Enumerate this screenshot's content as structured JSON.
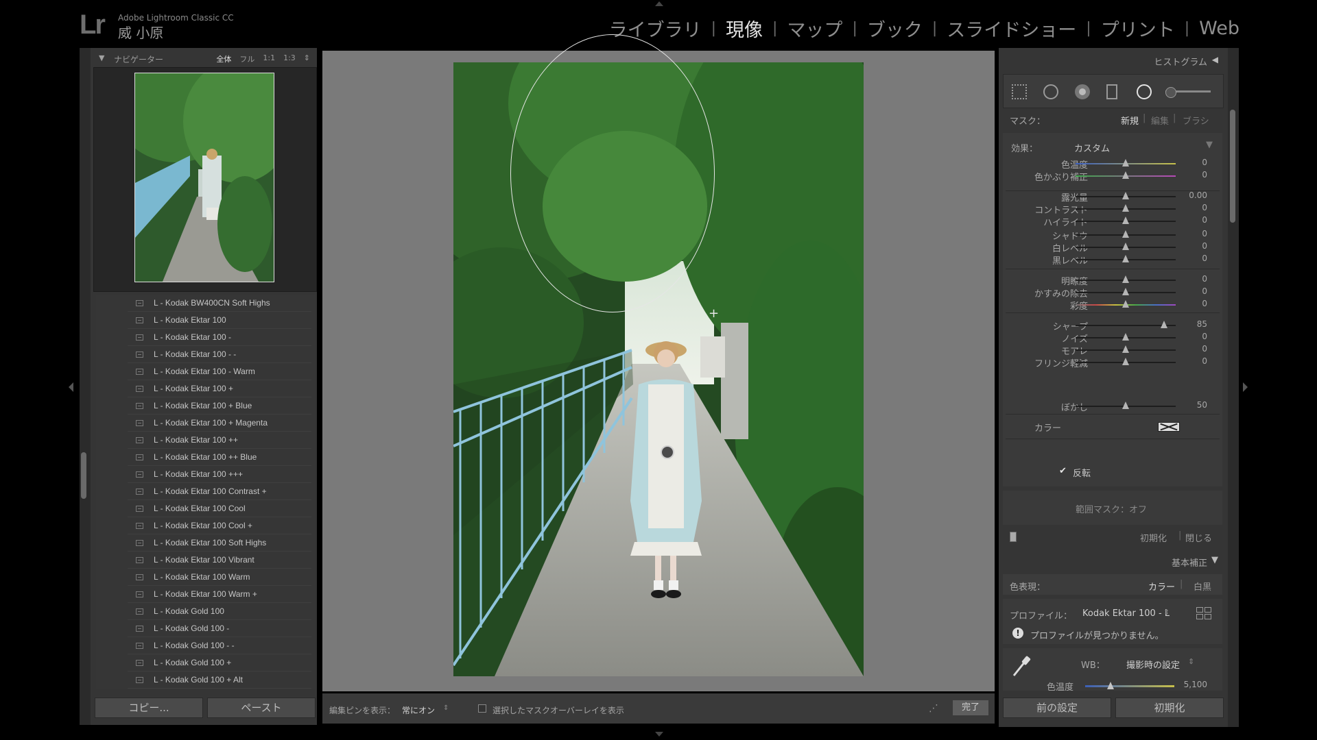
{
  "app": {
    "logo": "Lr",
    "product": "Adobe Lightroom Classic CC",
    "user": "威 小原"
  },
  "modules": [
    {
      "label": "ライブラリ",
      "active": false
    },
    {
      "label": "現像",
      "active": true
    },
    {
      "label": "マップ",
      "active": false
    },
    {
      "label": "ブック",
      "active": false
    },
    {
      "label": "スライドショー",
      "active": false
    },
    {
      "label": "プリント",
      "active": false
    },
    {
      "label": "Web",
      "active": false
    }
  ],
  "navigator": {
    "title": "ナビゲーター",
    "zoom_options": [
      "全体",
      "フル",
      "1:1",
      "1:3"
    ],
    "zoom_active": "全体"
  },
  "presets": [
    "L - Kodak BW400CN Soft Highs",
    "L - Kodak Ektar 100",
    "L - Kodak Ektar 100 -",
    "L - Kodak Ektar 100 - -",
    "L - Kodak Ektar 100 - Warm",
    "L - Kodak Ektar 100 +",
    "L - Kodak Ektar 100 + Blue",
    "L - Kodak Ektar 100 + Magenta",
    "L - Kodak Ektar 100 ++",
    "L - Kodak Ektar 100 ++ Blue",
    "L - Kodak Ektar 100 +++",
    "L - Kodak Ektar 100 Contrast +",
    "L - Kodak Ektar 100 Cool",
    "L - Kodak Ektar 100 Cool +",
    "L - Kodak Ektar 100 Soft Highs",
    "L - Kodak Ektar 100 Vibrant",
    "L - Kodak Ektar 100 Warm",
    "L - Kodak Ektar 100 Warm +",
    "L - Kodak Gold 100",
    "L - Kodak Gold 100 -",
    "L - Kodak Gold 100 - -",
    "L - Kodak Gold 100 +",
    "L - Kodak Gold 100 + Alt"
  ],
  "left_buttons": {
    "copy": "コピー...",
    "paste": "ペースト"
  },
  "toolbar": {
    "pin_label": "編集ピンを表示：",
    "pin_value": "常にオン",
    "overlay_label": "選択したマスクオーバーレイを表示",
    "done": "完了"
  },
  "histogram": {
    "title": "ヒストグラム"
  },
  "mask": {
    "label": "マスク：",
    "new": "新規",
    "edit": "編集",
    "brush": "ブラシ"
  },
  "effect": {
    "label": "効果：",
    "value": "カスタム"
  },
  "sliders": [
    {
      "label": "色温度",
      "value": "0",
      "pos": 0.5
    },
    {
      "label": "色かぶり補正",
      "value": "0",
      "pos": 0.5
    },
    {
      "label": "露光量",
      "value": "0.00",
      "pos": 0.5
    },
    {
      "label": "コントラスト",
      "value": "0",
      "pos": 0.5
    },
    {
      "label": "ハイライト",
      "value": "0",
      "pos": 0.5
    },
    {
      "label": "シャドウ",
      "value": "0",
      "pos": 0.5
    },
    {
      "label": "白レベル",
      "value": "0",
      "pos": 0.5
    },
    {
      "label": "黒レベル",
      "value": "0",
      "pos": 0.5
    },
    {
      "label": "明瞭度",
      "value": "0",
      "pos": 0.5
    },
    {
      "label": "かすみの除去",
      "value": "0",
      "pos": 0.5
    },
    {
      "label": "彩度",
      "value": "0",
      "pos": 0.5
    },
    {
      "label": "シャープ",
      "value": "85",
      "pos": 0.885
    },
    {
      "label": "ノイズ",
      "value": "0",
      "pos": 0.5
    },
    {
      "label": "モアレ",
      "value": "0",
      "pos": 0.5
    },
    {
      "label": "フリンジ軽減",
      "value": "0",
      "pos": 0.5
    },
    {
      "label": "ぼかし",
      "value": "50",
      "pos": 0.5
    }
  ],
  "color_label": "カラー",
  "invert": {
    "checked": true,
    "label": "反転"
  },
  "range_mask": "範囲マスク：オフ",
  "mask_footer": {
    "reset": "初期化",
    "close": "閉じる"
  },
  "basic": {
    "title": "基本補正",
    "treatment_label": "色表現：",
    "treatment_color": "カラー",
    "treatment_bw": "白黒",
    "profile_label": "プロファイル：",
    "profile_value": "Kodak Ektar 100 - L",
    "profile_warning": "プロファイルが見つかりません。",
    "wb_label": "WB：",
    "wb_value": "撮影時の設定",
    "temp_label": "色温度",
    "temp_value": "5,100"
  },
  "right_buttons": {
    "previous": "前の設定",
    "reset": "初期化"
  }
}
